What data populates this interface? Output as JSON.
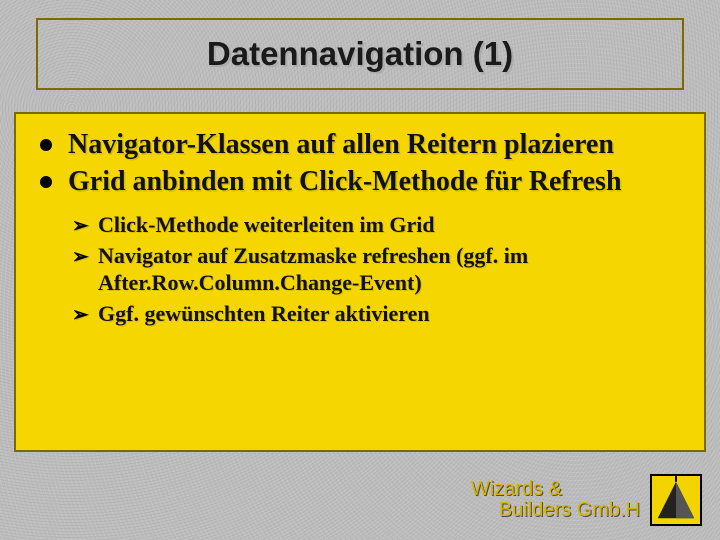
{
  "title": "Datennavigation (1)",
  "bullets": [
    "Navigator-Klassen auf allen Reitern plazieren",
    "Grid anbinden mit Click-Methode für Refresh"
  ],
  "subbullets": [
    "Click-Methode weiterleiten im Grid",
    "Navigator auf Zusatzmaske refreshen (ggf. im After.Row.Column.Change-Event)",
    "Ggf. gewünschten Reiter aktivieren"
  ],
  "footer": {
    "line1": "Wizards &",
    "line2": "Builders Gmb.H"
  },
  "colors": {
    "content_bg": "#f5d600",
    "border": "#7a6a00",
    "footer": "#d8b400"
  }
}
